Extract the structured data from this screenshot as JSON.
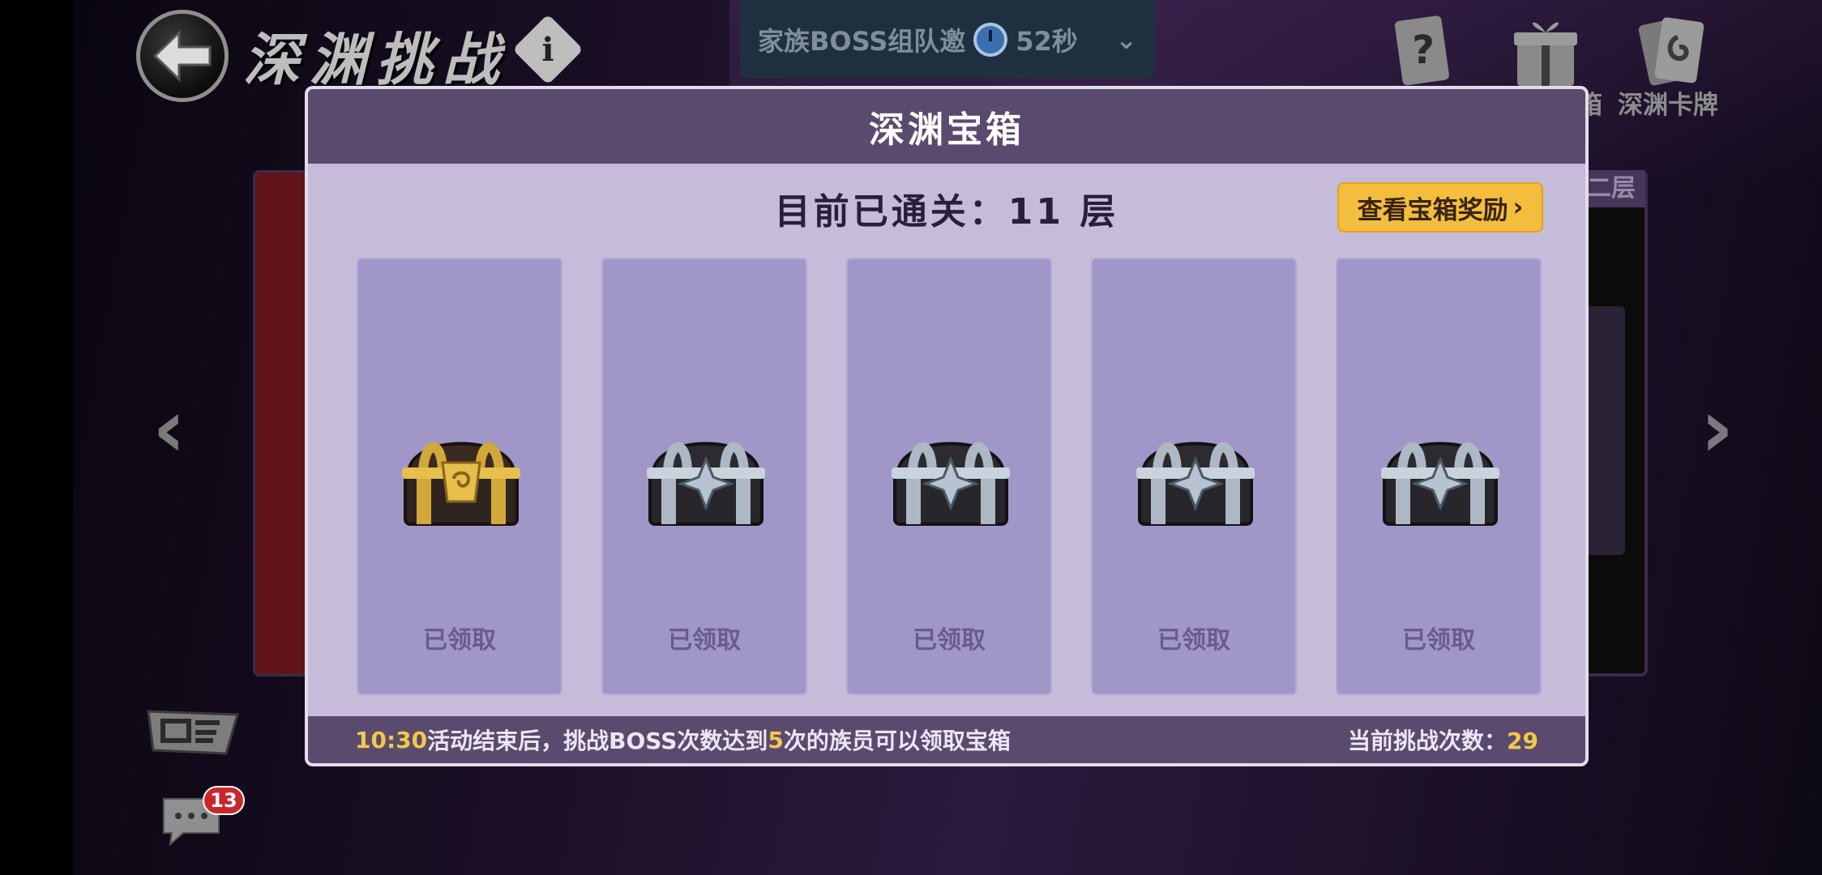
{
  "header": {
    "title": "深渊挑战",
    "invite": {
      "label": "家族BOSS组队邀",
      "timer": "52秒"
    },
    "top_icons": [
      {
        "name": "question-card-icon",
        "label": ""
      },
      {
        "name": "gift-box-icon",
        "label": "箱"
      },
      {
        "name": "abyss-card-icon",
        "label": "深渊卡牌"
      }
    ]
  },
  "background": {
    "right_panel_label": "二层"
  },
  "chat": {
    "badge": "13"
  },
  "modal": {
    "title": "深渊宝箱",
    "progress_label": "目前已通关：",
    "progress_value": "11",
    "progress_unit": "层",
    "view_reward_button": "查看宝箱奖励",
    "chests": [
      {
        "type": "gold",
        "status": "已领取"
      },
      {
        "type": "silver",
        "status": "已领取"
      },
      {
        "type": "silver",
        "status": "已领取"
      },
      {
        "type": "silver",
        "status": "已领取"
      },
      {
        "type": "silver",
        "status": "已领取"
      }
    ],
    "footer": {
      "time": "10:30",
      "text1": "活动结束后，挑战BOSS次数达到",
      "times_needed": "5",
      "text2": "次的族员可以领取宝箱",
      "count_label": "当前挑战次数：",
      "count_value": "29"
    }
  },
  "colors": {
    "modal_bg": "#c6bcd9",
    "header_bg": "#5a4b6e",
    "card_bg": "#a097c8",
    "button_bg": "#f3be3e",
    "highlight": "#f3c84a"
  }
}
